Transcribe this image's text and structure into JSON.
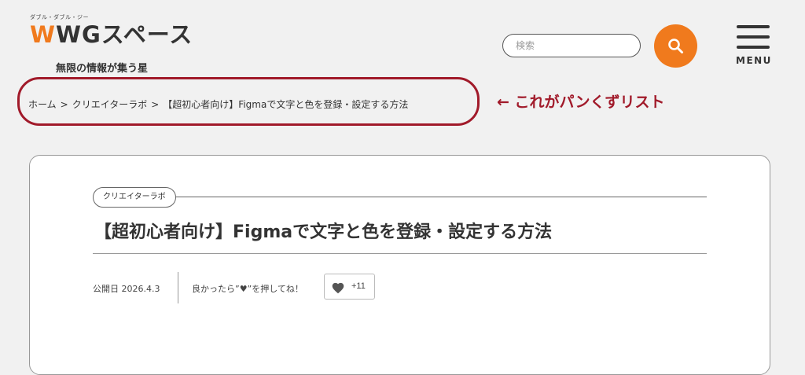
{
  "header": {
    "logo_kana": "ダブル・ダブル・ジー",
    "logo_accent": "W",
    "logo_rest": "WGスペース",
    "tagline": "無限の情報が集う星",
    "search_placeholder": "検索",
    "search_icon": "search-icon",
    "menu_label": "MENU",
    "accent_color": "#f07a1d"
  },
  "breadcrumb": {
    "items": [
      "ホーム",
      "クリエイターラボ",
      "【超初心者向け】Figmaで文字と色を登録・設定する方法"
    ],
    "separator": ">",
    "annotation": "← これがパンくずリスト",
    "highlight_color": "#a11a2a"
  },
  "article": {
    "category": "クリエイターラボ",
    "title": "【超初心者向け】Figmaで文字と色を登録・設定する方法",
    "published": "公開日 2026.4.3",
    "like_prompt": "良かったら”♥”を押してね！",
    "like_count": "+11"
  }
}
